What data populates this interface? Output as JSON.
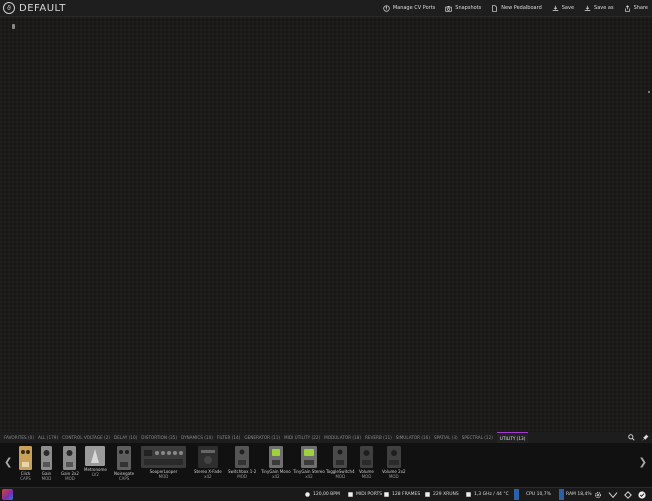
{
  "header": {
    "title": "DEFAULT",
    "logo_symbol": "ϑ",
    "actions": [
      {
        "label": "Manage CV Ports",
        "icon": "cv-ports-icon"
      },
      {
        "label": "Snapshots",
        "icon": "camera-icon"
      },
      {
        "label": "New Pedalboard",
        "icon": "new-file-icon"
      },
      {
        "label": "Save",
        "icon": "save-icon"
      },
      {
        "label": "Save as",
        "icon": "save-as-icon"
      },
      {
        "label": "Share",
        "icon": "share-icon"
      }
    ]
  },
  "categories": [
    {
      "label": "FAVORITES (0)"
    },
    {
      "label": "ALL (179)"
    },
    {
      "label": "CONTROL VOLTAGE (2)"
    },
    {
      "label": "DELAY (10)"
    },
    {
      "label": "DISTORTION (35)"
    },
    {
      "label": "DYNAMICS (10)"
    },
    {
      "label": "FILTER (14)"
    },
    {
      "label": "GENERATOR (11)"
    },
    {
      "label": "MIDI UTILITY (22)"
    },
    {
      "label": "MODULATOR (18)"
    },
    {
      "label": "REVERB (11)"
    },
    {
      "label": "SIMULATOR (16)"
    },
    {
      "label": "SPATIAL (3)"
    },
    {
      "label": "SPECTRAL (12)"
    },
    {
      "label": "UTILITY (13)",
      "active": true
    }
  ],
  "plugins": [
    {
      "name": "Click",
      "brand": "CAPS"
    },
    {
      "name": "Gain",
      "brand": "MOD"
    },
    {
      "name": "Gain 2x2",
      "brand": "MOD"
    },
    {
      "name": "Metronome",
      "brand": "LV2"
    },
    {
      "name": "Noisegate",
      "brand": "CAPS"
    },
    {
      "name": "SooperLooper",
      "brand": "MOD"
    },
    {
      "name": "Stereo X-Fade",
      "brand": "x42"
    },
    {
      "name": "Switchbox 1-2",
      "brand": "MOD"
    },
    {
      "name": "TinyGain Mono",
      "brand": "x42"
    },
    {
      "name": "TinyGain Stereo",
      "brand": "x42"
    },
    {
      "name": "ToggleSwitch4",
      "brand": "MOD"
    },
    {
      "name": "Volume",
      "brand": "MOD"
    },
    {
      "name": "Volume 2x2",
      "brand": "MOD"
    }
  ],
  "status": {
    "bpm": "120,00 BPM",
    "midi_ports": "MIDI PORTS",
    "frames": "128 FRAMES",
    "xruns": "229 XRUNS",
    "clock": "1,3 GHz / 44 °C",
    "cpu": "CPU 10,7%",
    "ram": "RAM 18,4%"
  },
  "colors": {
    "accent": "#a33ad1",
    "meter": "#2b5fa8"
  }
}
